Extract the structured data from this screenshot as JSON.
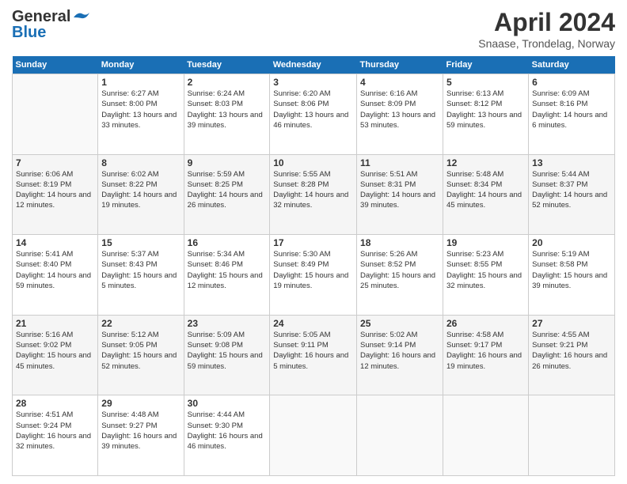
{
  "header": {
    "logo_general": "General",
    "logo_blue": "Blue",
    "month_title": "April 2024",
    "location": "Snaase, Trondelag, Norway"
  },
  "days_of_week": [
    "Sunday",
    "Monday",
    "Tuesday",
    "Wednesday",
    "Thursday",
    "Friday",
    "Saturday"
  ],
  "weeks": [
    [
      {
        "day": "",
        "sunrise": "",
        "sunset": "",
        "daylight": ""
      },
      {
        "day": "1",
        "sunrise": "Sunrise: 6:27 AM",
        "sunset": "Sunset: 8:00 PM",
        "daylight": "Daylight: 13 hours and 33 minutes."
      },
      {
        "day": "2",
        "sunrise": "Sunrise: 6:24 AM",
        "sunset": "Sunset: 8:03 PM",
        "daylight": "Daylight: 13 hours and 39 minutes."
      },
      {
        "day": "3",
        "sunrise": "Sunrise: 6:20 AM",
        "sunset": "Sunset: 8:06 PM",
        "daylight": "Daylight: 13 hours and 46 minutes."
      },
      {
        "day": "4",
        "sunrise": "Sunrise: 6:16 AM",
        "sunset": "Sunset: 8:09 PM",
        "daylight": "Daylight: 13 hours and 53 minutes."
      },
      {
        "day": "5",
        "sunrise": "Sunrise: 6:13 AM",
        "sunset": "Sunset: 8:12 PM",
        "daylight": "Daylight: 13 hours and 59 minutes."
      },
      {
        "day": "6",
        "sunrise": "Sunrise: 6:09 AM",
        "sunset": "Sunset: 8:16 PM",
        "daylight": "Daylight: 14 hours and 6 minutes."
      }
    ],
    [
      {
        "day": "7",
        "sunrise": "Sunrise: 6:06 AM",
        "sunset": "Sunset: 8:19 PM",
        "daylight": "Daylight: 14 hours and 12 minutes."
      },
      {
        "day": "8",
        "sunrise": "Sunrise: 6:02 AM",
        "sunset": "Sunset: 8:22 PM",
        "daylight": "Daylight: 14 hours and 19 minutes."
      },
      {
        "day": "9",
        "sunrise": "Sunrise: 5:59 AM",
        "sunset": "Sunset: 8:25 PM",
        "daylight": "Daylight: 14 hours and 26 minutes."
      },
      {
        "day": "10",
        "sunrise": "Sunrise: 5:55 AM",
        "sunset": "Sunset: 8:28 PM",
        "daylight": "Daylight: 14 hours and 32 minutes."
      },
      {
        "day": "11",
        "sunrise": "Sunrise: 5:51 AM",
        "sunset": "Sunset: 8:31 PM",
        "daylight": "Daylight: 14 hours and 39 minutes."
      },
      {
        "day": "12",
        "sunrise": "Sunrise: 5:48 AM",
        "sunset": "Sunset: 8:34 PM",
        "daylight": "Daylight: 14 hours and 45 minutes."
      },
      {
        "day": "13",
        "sunrise": "Sunrise: 5:44 AM",
        "sunset": "Sunset: 8:37 PM",
        "daylight": "Daylight: 14 hours and 52 minutes."
      }
    ],
    [
      {
        "day": "14",
        "sunrise": "Sunrise: 5:41 AM",
        "sunset": "Sunset: 8:40 PM",
        "daylight": "Daylight: 14 hours and 59 minutes."
      },
      {
        "day": "15",
        "sunrise": "Sunrise: 5:37 AM",
        "sunset": "Sunset: 8:43 PM",
        "daylight": "Daylight: 15 hours and 5 minutes."
      },
      {
        "day": "16",
        "sunrise": "Sunrise: 5:34 AM",
        "sunset": "Sunset: 8:46 PM",
        "daylight": "Daylight: 15 hours and 12 minutes."
      },
      {
        "day": "17",
        "sunrise": "Sunrise: 5:30 AM",
        "sunset": "Sunset: 8:49 PM",
        "daylight": "Daylight: 15 hours and 19 minutes."
      },
      {
        "day": "18",
        "sunrise": "Sunrise: 5:26 AM",
        "sunset": "Sunset: 8:52 PM",
        "daylight": "Daylight: 15 hours and 25 minutes."
      },
      {
        "day": "19",
        "sunrise": "Sunrise: 5:23 AM",
        "sunset": "Sunset: 8:55 PM",
        "daylight": "Daylight: 15 hours and 32 minutes."
      },
      {
        "day": "20",
        "sunrise": "Sunrise: 5:19 AM",
        "sunset": "Sunset: 8:58 PM",
        "daylight": "Daylight: 15 hours and 39 minutes."
      }
    ],
    [
      {
        "day": "21",
        "sunrise": "Sunrise: 5:16 AM",
        "sunset": "Sunset: 9:02 PM",
        "daylight": "Daylight: 15 hours and 45 minutes."
      },
      {
        "day": "22",
        "sunrise": "Sunrise: 5:12 AM",
        "sunset": "Sunset: 9:05 PM",
        "daylight": "Daylight: 15 hours and 52 minutes."
      },
      {
        "day": "23",
        "sunrise": "Sunrise: 5:09 AM",
        "sunset": "Sunset: 9:08 PM",
        "daylight": "Daylight: 15 hours and 59 minutes."
      },
      {
        "day": "24",
        "sunrise": "Sunrise: 5:05 AM",
        "sunset": "Sunset: 9:11 PM",
        "daylight": "Daylight: 16 hours and 5 minutes."
      },
      {
        "day": "25",
        "sunrise": "Sunrise: 5:02 AM",
        "sunset": "Sunset: 9:14 PM",
        "daylight": "Daylight: 16 hours and 12 minutes."
      },
      {
        "day": "26",
        "sunrise": "Sunrise: 4:58 AM",
        "sunset": "Sunset: 9:17 PM",
        "daylight": "Daylight: 16 hours and 19 minutes."
      },
      {
        "day": "27",
        "sunrise": "Sunrise: 4:55 AM",
        "sunset": "Sunset: 9:21 PM",
        "daylight": "Daylight: 16 hours and 26 minutes."
      }
    ],
    [
      {
        "day": "28",
        "sunrise": "Sunrise: 4:51 AM",
        "sunset": "Sunset: 9:24 PM",
        "daylight": "Daylight: 16 hours and 32 minutes."
      },
      {
        "day": "29",
        "sunrise": "Sunrise: 4:48 AM",
        "sunset": "Sunset: 9:27 PM",
        "daylight": "Daylight: 16 hours and 39 minutes."
      },
      {
        "day": "30",
        "sunrise": "Sunrise: 4:44 AM",
        "sunset": "Sunset: 9:30 PM",
        "daylight": "Daylight: 16 hours and 46 minutes."
      },
      {
        "day": "",
        "sunrise": "",
        "sunset": "",
        "daylight": ""
      },
      {
        "day": "",
        "sunrise": "",
        "sunset": "",
        "daylight": ""
      },
      {
        "day": "",
        "sunrise": "",
        "sunset": "",
        "daylight": ""
      },
      {
        "day": "",
        "sunrise": "",
        "sunset": "",
        "daylight": ""
      }
    ]
  ]
}
